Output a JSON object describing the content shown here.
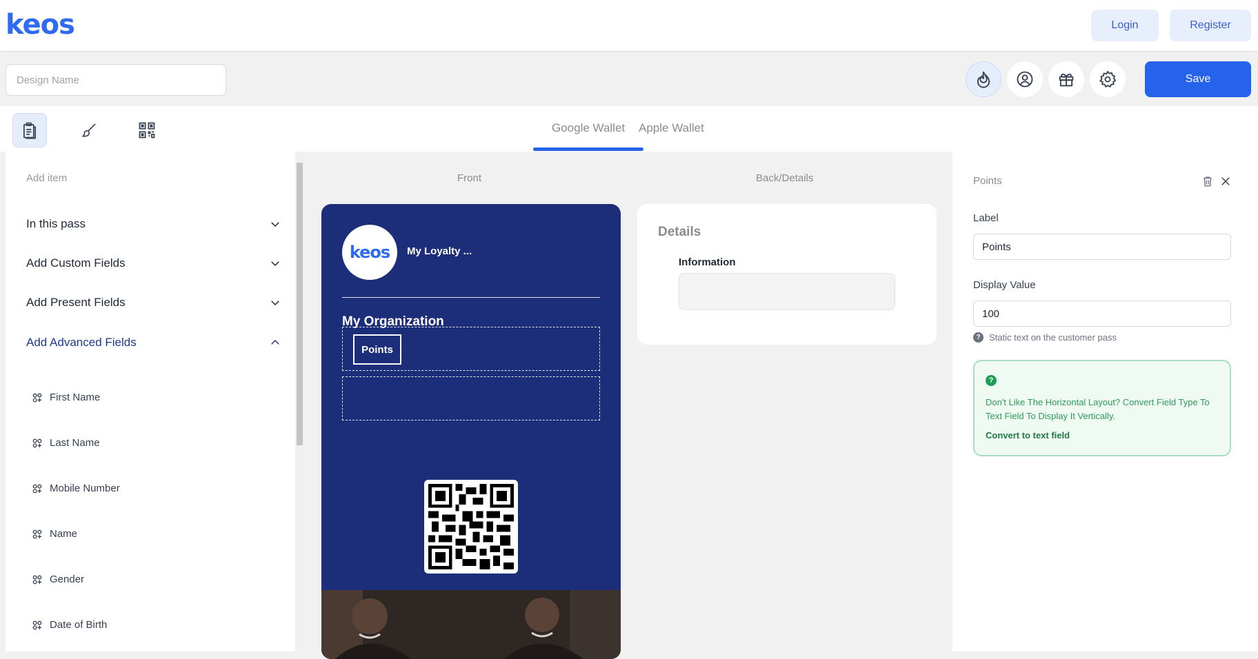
{
  "header": {
    "logo": "keos",
    "login_label": "Login",
    "register_label": "Register"
  },
  "toolbar": {
    "design_name_placeholder": "Design Name",
    "design_name_value": "",
    "save_label": "Save",
    "icons": [
      "flame-icon",
      "user-circle-icon",
      "gift-icon",
      "gear-icon"
    ]
  },
  "tabs": {
    "tools": [
      "clipboard-icon",
      "brush-icon",
      "qr-icon"
    ],
    "wallets": [
      "Google Wallet",
      "Apple Wallet"
    ],
    "active_wallet": "Google Wallet"
  },
  "sidebar": {
    "add_item_label": "Add item",
    "sections": [
      {
        "label": "In this pass",
        "open": false
      },
      {
        "label": "Add Custom Fields",
        "open": false
      },
      {
        "label": "Add Present Fields",
        "open": false
      },
      {
        "label": "Add Advanced Fields",
        "open": true
      }
    ],
    "fields": [
      "First Name",
      "Last Name",
      "Mobile Number",
      "Name",
      "Gender",
      "Date of Birth"
    ]
  },
  "preview": {
    "front_label": "Front",
    "back_label": "Back/Details",
    "pass": {
      "logo_text": "keos",
      "program_name": "My Loyalty ...",
      "organization": "My Organization",
      "points_chip": "Points",
      "background_color": "#1c2d7a"
    },
    "details": {
      "title": "Details",
      "info_label": "Information"
    }
  },
  "properties": {
    "title": "Points",
    "label_caption": "Label",
    "label_value": "Points",
    "display_value_caption": "Display Value",
    "display_value": "100",
    "hint": "Static text on the customer pass",
    "tip_message": "Don't Like The Horizontal Layout? Convert Field Type To Text Field To Display It Vertically.",
    "tip_link": "Convert to text field"
  }
}
